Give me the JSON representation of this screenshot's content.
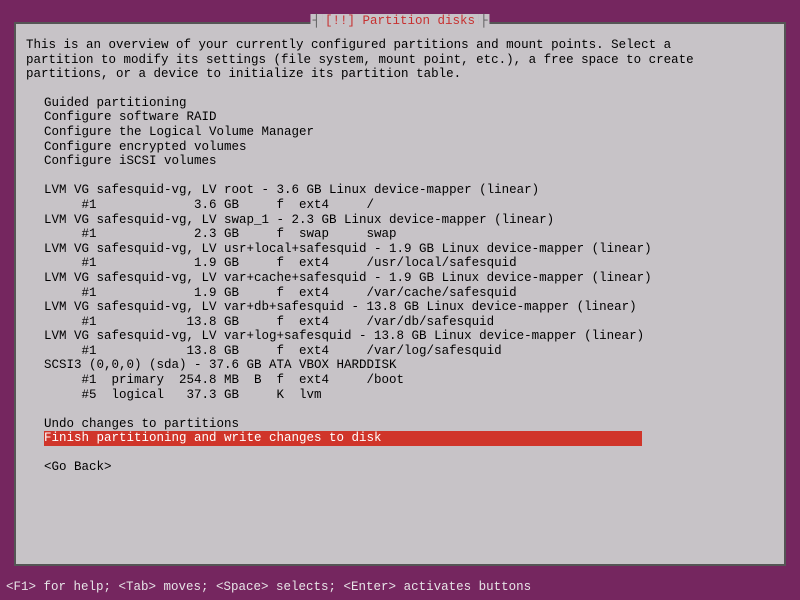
{
  "dialog": {
    "title_prefix": "┤",
    "title": " [!!] Partition disks ",
    "title_suffix": "├",
    "description": "This is an overview of your currently configured partitions and mount points. Select a\npartition to modify its settings (file system, mount point, etc.), a free space to create\npartitions, or a device to initialize its partition table."
  },
  "guided": {
    "items": [
      "Guided partitioning",
      "Configure software RAID",
      "Configure the Logical Volume Manager",
      "Configure encrypted volumes",
      "Configure iSCSI volumes"
    ]
  },
  "partitions": {
    "lines": [
      "LVM VG safesquid-vg, LV root - 3.6 GB Linux device-mapper (linear)",
      "     #1             3.6 GB     f  ext4     /",
      "LVM VG safesquid-vg, LV swap_1 - 2.3 GB Linux device-mapper (linear)",
      "     #1             2.3 GB     f  swap     swap",
      "LVM VG safesquid-vg, LV usr+local+safesquid - 1.9 GB Linux device-mapper (linear)",
      "     #1             1.9 GB     f  ext4     /usr/local/safesquid",
      "LVM VG safesquid-vg, LV var+cache+safesquid - 1.9 GB Linux device-mapper (linear)",
      "     #1             1.9 GB     f  ext4     /var/cache/safesquid",
      "LVM VG safesquid-vg, LV var+db+safesquid - 13.8 GB Linux device-mapper (linear)",
      "     #1            13.8 GB     f  ext4     /var/db/safesquid",
      "LVM VG safesquid-vg, LV var+log+safesquid - 13.8 GB Linux device-mapper (linear)",
      "     #1            13.8 GB     f  ext4     /var/log/safesquid",
      "SCSI3 (0,0,0) (sda) - 37.6 GB ATA VBOX HARDDISK",
      "     #1  primary  254.8 MB  B  f  ext4     /boot",
      "     #5  logical   37.3 GB     K  lvm"
    ]
  },
  "actions": {
    "undo": "Undo changes to partitions",
    "finish": "Finish partitioning and write changes to disk",
    "go_back": "<Go Back>"
  },
  "footer": {
    "text": "<F1> for help; <Tab> moves; <Space> selects; <Enter> activates buttons"
  }
}
